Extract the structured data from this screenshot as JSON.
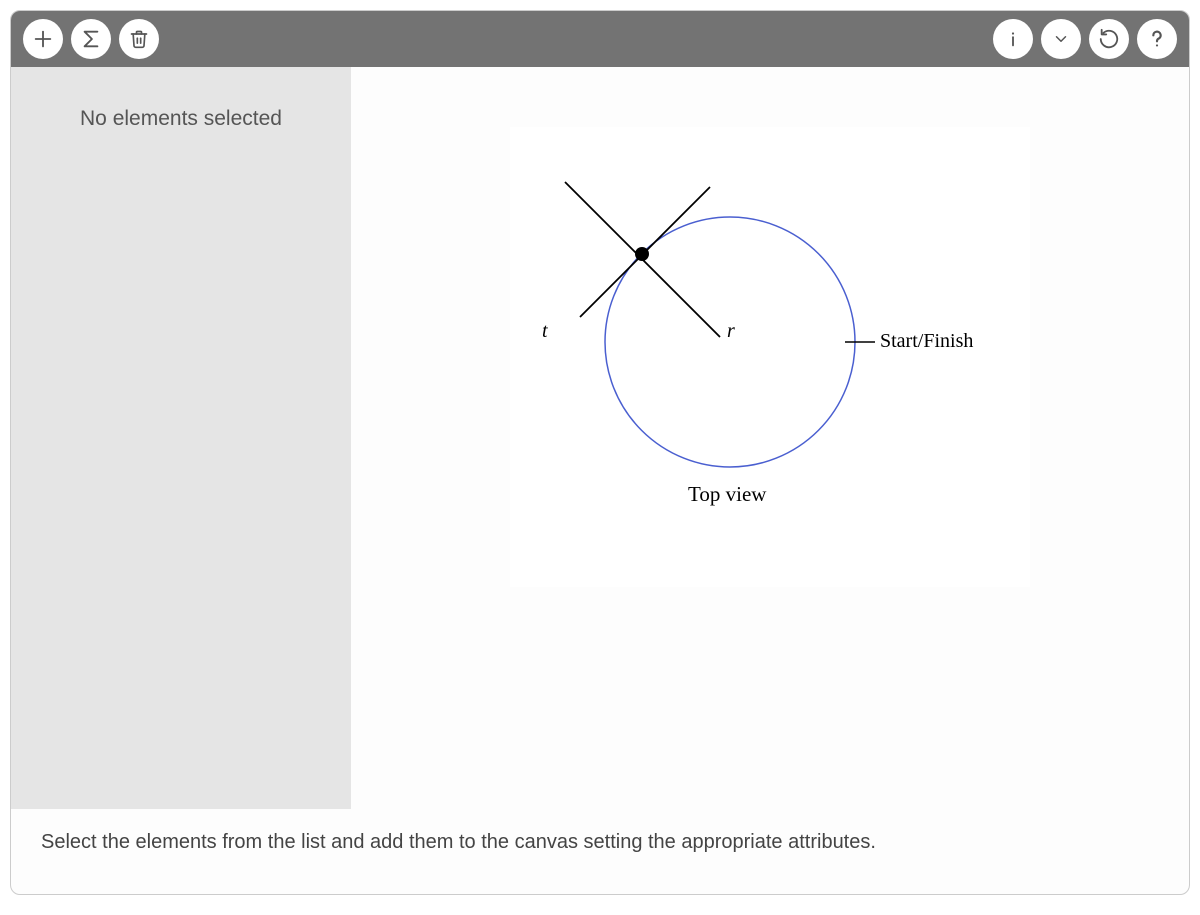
{
  "sidebar": {
    "empty_message": "No elements selected"
  },
  "instructions": "Select the elements from the list and add them to the canvas setting the appropriate attributes.",
  "diagram": {
    "label_t": "t",
    "label_r": "r",
    "label_start_finish": "Start/Finish",
    "caption": "Top view"
  },
  "toolbar": {
    "add": "add",
    "sum": "sum",
    "delete": "delete",
    "info": "info",
    "dropdown": "dropdown",
    "reset": "reset",
    "help": "help"
  }
}
